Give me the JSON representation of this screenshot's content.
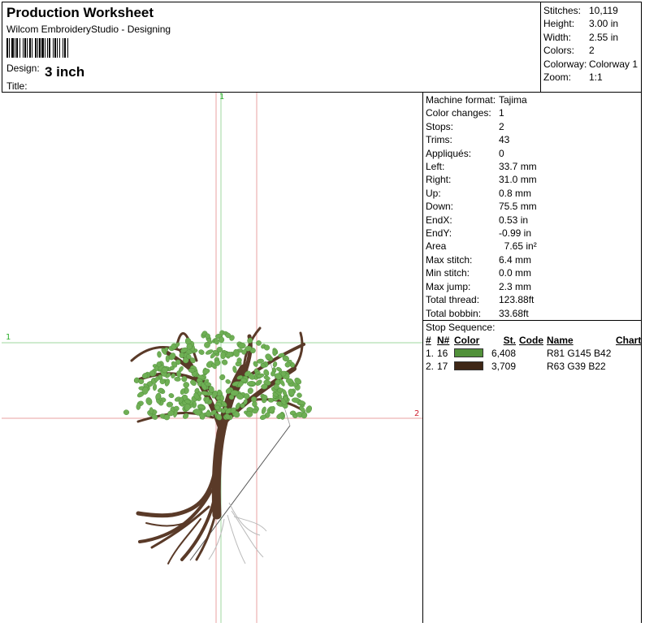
{
  "header": {
    "title": "Production Worksheet",
    "subtitle": "Wilcom EmbroideryStudio - Designing",
    "design_label": "Design:",
    "design_value": "3 inch",
    "title_label": "Title:",
    "title_value": ""
  },
  "stats": [
    {
      "label": "Stitches:",
      "value": "10,119"
    },
    {
      "label": "Height:",
      "value": "3.00 in"
    },
    {
      "label": "Width:",
      "value": "2.55 in"
    },
    {
      "label": "Colors:",
      "value": "2"
    },
    {
      "label": "Colorway:",
      "value": "Colorway 1"
    },
    {
      "label": "Zoom:",
      "value": "1:1"
    }
  ],
  "machine": [
    {
      "label": "Machine format:",
      "value": "Tajima"
    },
    {
      "label": "Color changes:",
      "value": "1"
    },
    {
      "label": "Stops:",
      "value": "2"
    },
    {
      "label": "Trims:",
      "value": "43"
    },
    {
      "label": "Appliqués:",
      "value": "0"
    },
    {
      "label": "Left:",
      "value": "33.7 mm"
    },
    {
      "label": "Right:",
      "value": "31.0 mm"
    },
    {
      "label": "Up:",
      "value": "0.8 mm"
    },
    {
      "label": "Down:",
      "value": "75.5 mm"
    },
    {
      "label": "EndX:",
      "value": "0.53 in"
    },
    {
      "label": "EndY:",
      "value": "-0.99 in"
    },
    {
      "label": "Area",
      "value": "  7.65 in²"
    },
    {
      "label": "Max stitch:",
      "value": "6.4 mm"
    },
    {
      "label": "Min stitch:",
      "value": "0.0 mm"
    },
    {
      "label": "Max jump:",
      "value": "2.3 mm"
    },
    {
      "label": "Total thread:",
      "value": "123.88ft"
    },
    {
      "label": "Total bobbin:",
      "value": "33.68ft"
    }
  ],
  "stop_sequence": {
    "title": "Stop Sequence:",
    "headers": {
      "num": "#",
      "n": "N#",
      "color": "Color",
      "st": "St.",
      "code": "Code",
      "name": "Name",
      "chart": "Chart"
    },
    "rows": [
      {
        "num": "1.",
        "n": "16",
        "color": "#51913A",
        "st": "6,408",
        "code": "",
        "name": "R81 G145 B42",
        "chart": ""
      },
      {
        "num": "2.",
        "n": "17",
        "color": "#3F2716",
        "st": "3,709",
        "code": "",
        "name": "R63 G39 B22",
        "chart": ""
      }
    ]
  },
  "markers": {
    "top": "1",
    "left": "1",
    "right": "2"
  },
  "colors": {
    "leaf": "#6FAF55",
    "trunk": "#5A3A28",
    "guide_red": "#E8A0A0",
    "guide_green": "#9FD79F",
    "marker_red": "#D02030",
    "marker_green": "#2CB02C"
  }
}
